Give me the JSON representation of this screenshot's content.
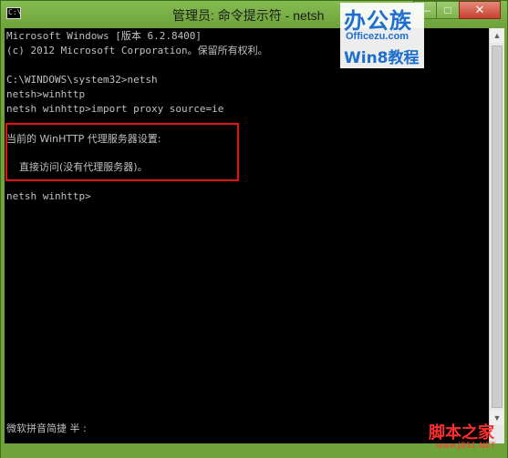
{
  "window": {
    "title": "管理员: 命令提示符 - netsh",
    "app_icon_text": "C:\\",
    "buttons": {
      "minimize": "—",
      "maximize": "□",
      "close": "✕"
    }
  },
  "console": {
    "lines": [
      "Microsoft Windows [版本 6.2.8400]",
      "(c) 2012 Microsoft Corporation。保留所有权利。",
      "",
      "C:\\WINDOWS\\system32>netsh",
      "netsh>winhttp",
      "netsh winhttp>import proxy source=ie",
      "当前的 WinHTTP 代理服务器设置:",
      "    直接访问(没有代理服务器)。",
      "netsh winhttp>"
    ],
    "ime_status": "微软拼音简捷 半 :"
  },
  "watermarks": {
    "top_brand": "办公族",
    "top_url": "Officezu.com",
    "top_sub": "Win8教程",
    "bottom_brand": "脚本之家",
    "bottom_url": "www.JB51.NET"
  },
  "colors": {
    "titlebar": "#6fa33a",
    "console_bg": "#000000",
    "console_text": "#c0c0c0",
    "highlight_border": "#e8120f",
    "watermark_blue": "#1f6fcf",
    "watermark_red": "#ff2d2d"
  },
  "icons": {
    "app": "console-icon",
    "minimize": "minimize-icon",
    "maximize": "maximize-icon",
    "close": "close-icon"
  }
}
